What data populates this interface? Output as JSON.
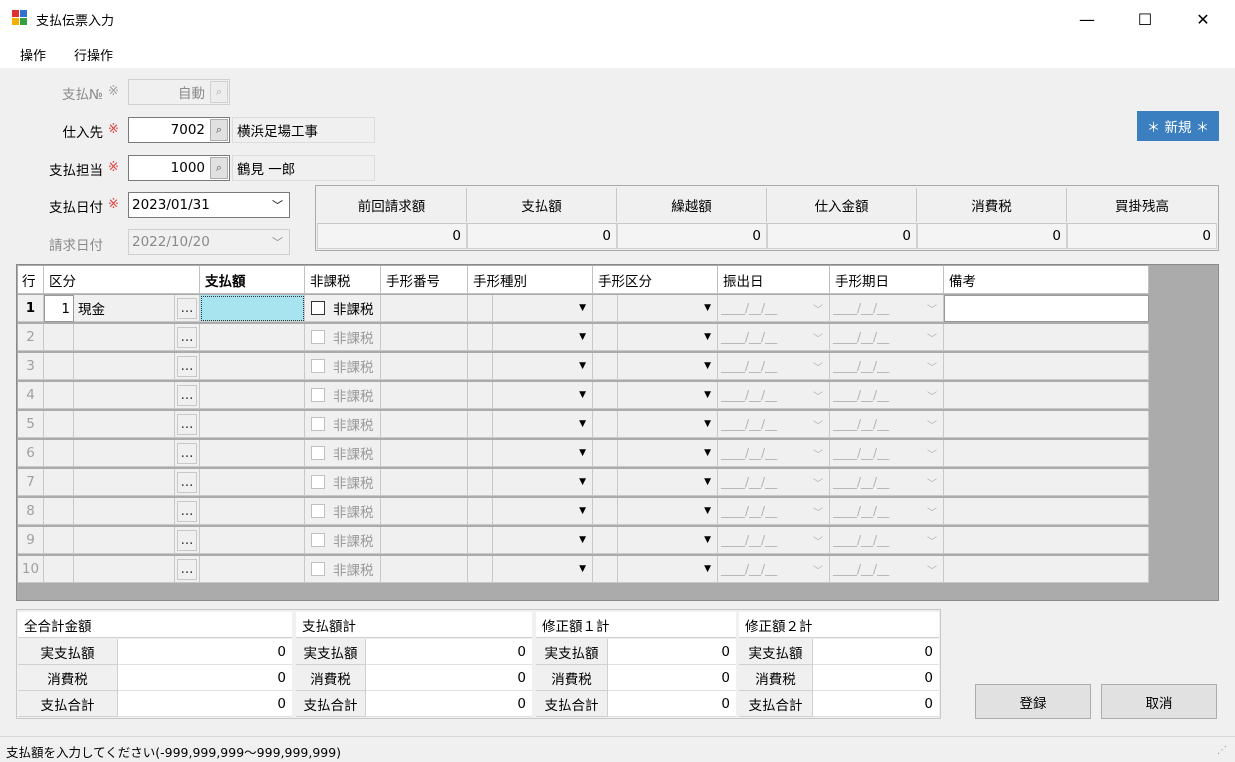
{
  "window": {
    "title": "支払伝票入力",
    "minimize": "—",
    "maximize": "☐",
    "close": "✕"
  },
  "menu": [
    {
      "label": "操作"
    },
    {
      "label": "行操作"
    }
  ],
  "form": {
    "payment_no": {
      "label": "支払№",
      "value": "自動"
    },
    "supplier": {
      "label": "仕入先",
      "code": "7002",
      "name": "横浜足場工事"
    },
    "staff": {
      "label": "支払担当",
      "code": "1000",
      "name": "鶴見 一郎"
    },
    "pay_date": {
      "label": "支払日付",
      "value": "2023/01/31"
    },
    "bill_date": {
      "label": "請求日付",
      "value": "2022/10/20"
    },
    "required_mark": "※",
    "new_badge": "＊ 新規 ＊"
  },
  "summary": {
    "headers": [
      "前回請求額",
      "支払額",
      "繰越額",
      "仕入金額",
      "消費税",
      "買掛残高"
    ],
    "values": [
      "0",
      "0",
      "0",
      "0",
      "0",
      "0"
    ]
  },
  "grid": {
    "headers": {
      "row": "行",
      "kind": "区分",
      "amount": "支払額",
      "tax": "非課税",
      "note_no": "手形番号",
      "note_type": "手形種別",
      "note_class": "手形区分",
      "issue": "振出日",
      "due": "手形期日",
      "memo": "備考"
    },
    "row1": {
      "no": "1",
      "kind_code": "1",
      "kind_name": "現金"
    },
    "rownums": [
      "2",
      "3",
      "4",
      "5",
      "6",
      "7",
      "8",
      "9",
      "10"
    ],
    "checkbox_label": "非課税",
    "ellipsis": "...",
    "date_mask": "____/__/__"
  },
  "totals": [
    {
      "title": "全合計金額",
      "rows": [
        {
          "label": "実支払額",
          "value": "0"
        },
        {
          "label": "消費税",
          "value": "0"
        },
        {
          "label": "支払合計",
          "value": "0"
        }
      ]
    },
    {
      "title": "支払額計",
      "rows": [
        {
          "label": "実支払額",
          "value": "0"
        },
        {
          "label": "消費税",
          "value": "0"
        },
        {
          "label": "支払合計",
          "value": "0"
        }
      ]
    },
    {
      "title": "修正額１計",
      "rows": [
        {
          "label": "実支払額",
          "value": "0"
        },
        {
          "label": "消費税",
          "value": "0"
        },
        {
          "label": "支払合計",
          "value": "0"
        }
      ]
    },
    {
      "title": "修正額２計",
      "rows": [
        {
          "label": "実支払額",
          "value": "0"
        },
        {
          "label": "消費税",
          "value": "0"
        },
        {
          "label": "支払合計",
          "value": "0"
        }
      ]
    }
  ],
  "buttons": {
    "register": "登録",
    "cancel": "取消"
  },
  "status": "支払額を入力してください(-999,999,999～999,999,999)"
}
